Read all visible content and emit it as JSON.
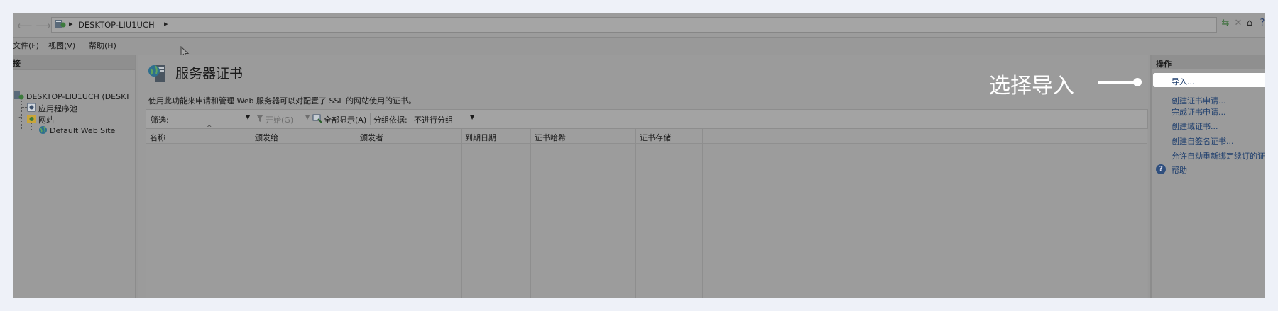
{
  "address_bar": {
    "path": "DESKTOP-LIU1UCH",
    "separator": "▸"
  },
  "toolbar_icons": [
    "network-icon",
    "stop-icon",
    "home-icon",
    "help-icon"
  ],
  "menu": {
    "file": "文件(F)",
    "view": "视图(V)",
    "help": "帮助(H)"
  },
  "connections": {
    "title": "接",
    "server": "DESKTOP-LIU1UCH (DESKT",
    "app_pools": "应用程序池",
    "sites": "网站",
    "default_site": "Default Web Site"
  },
  "main": {
    "title": "服务器证书",
    "description": "使用此功能来申请和管理 Web 服务器可以对配置了 SSL 的网站使用的证书。",
    "filter_label": "筛选:",
    "start_label": "开始(G)",
    "show_all_label": "全部显示(A)",
    "group_by_label": "分组依据:",
    "group_by_value": "不进行分组",
    "columns": [
      "名称",
      "颁发给",
      "颁发者",
      "到期日期",
      "证书哈希",
      "证书存储"
    ]
  },
  "actions": {
    "title": "操作",
    "import": "导入...",
    "create_request": "创建证书申请...",
    "complete_request": "完成证书申请...",
    "create_domain": "创建域证书...",
    "create_self_signed": "创建自签名证书...",
    "auto_rebind": "允许自动重新绑定续订的证书",
    "help": "帮助"
  },
  "annotation": {
    "text": "选择导入"
  },
  "colors": {
    "overlay_gray": "#999999",
    "link_blue": "#1f3f6e",
    "annotation_white": "#ffffff"
  }
}
